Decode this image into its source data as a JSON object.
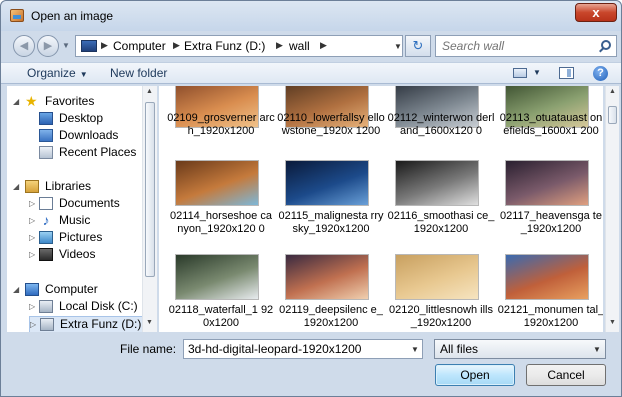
{
  "window": {
    "title": "Open an image",
    "close_label": "x"
  },
  "address": {
    "path": [
      "Computer",
      "Extra Funz (D:)",
      "wall"
    ],
    "search_placeholder": "Search wall"
  },
  "toolbar": {
    "organize": "Organize",
    "new_folder": "New folder",
    "help": "?"
  },
  "nav": {
    "favorites": "Favorites",
    "desktop": "Desktop",
    "downloads": "Downloads",
    "recent": "Recent Places",
    "libraries": "Libraries",
    "documents": "Documents",
    "music": "Music",
    "pictures": "Pictures",
    "videos": "Videos",
    "computer": "Computer",
    "local_disk": "Local Disk (C:)",
    "extra_funz": "Extra Funz (D:)"
  },
  "files": [
    {
      "name": "02109_grosverner arch_1920x1200",
      "thumb": [
        "#8a4b2a",
        "#d98d4f",
        "#f0c28a"
      ]
    },
    {
      "name": "02110_lowerfallsy ellowstone_1920x 1200",
      "thumb": [
        "#5a3a22",
        "#b07040",
        "#e7b27a"
      ]
    },
    {
      "name": "02112_winterwon derland_1600x120 0",
      "thumb": [
        "#2f3640",
        "#7d8790",
        "#c8ced4"
      ]
    },
    {
      "name": "02113_otuatauast onefields_1600x1 200",
      "thumb": [
        "#3c5030",
        "#8aa070",
        "#d6c89a"
      ]
    },
    {
      "name": "02114_horseshoe canyon_1920x120 0",
      "thumb": [
        "#6a3a1a",
        "#c57a3c",
        "#7db7d8"
      ]
    },
    {
      "name": "02115_malignesta rrysky_1920x1200",
      "thumb": [
        "#0a1a3a",
        "#1c4a8a",
        "#6aa0d8"
      ]
    },
    {
      "name": "02116_smoothasi ce_1920x1200",
      "thumb": [
        "#1a1a1a",
        "#7a7a7a",
        "#e0e0e0"
      ]
    },
    {
      "name": "02117_heavensga te_1920x1200",
      "thumb": [
        "#2a2030",
        "#7a5a6a",
        "#e0a080"
      ]
    },
    {
      "name": "02118_waterfall_1 920x1200",
      "thumb": [
        "#2a3a2a",
        "#7a8a70",
        "#e8ecef"
      ]
    },
    {
      "name": "02119_deepsilenc e_1920x1200",
      "thumb": [
        "#3a2a40",
        "#c07050",
        "#f0d0b0"
      ]
    },
    {
      "name": "02120_littlesnowh ills_1920x1200",
      "thumb": [
        "#c8a060",
        "#e8c890",
        "#f6e4c0"
      ]
    },
    {
      "name": "02121_monumen tal_1920x1200",
      "thumb": [
        "#3a6ab0",
        "#c0603a",
        "#e8a060"
      ]
    }
  ],
  "bottom": {
    "file_name_label": "File name:",
    "file_name_value": "3d-hd-digital-leopard-1920x1200",
    "file_type": "All files",
    "open": "Open",
    "cancel": "Cancel"
  }
}
